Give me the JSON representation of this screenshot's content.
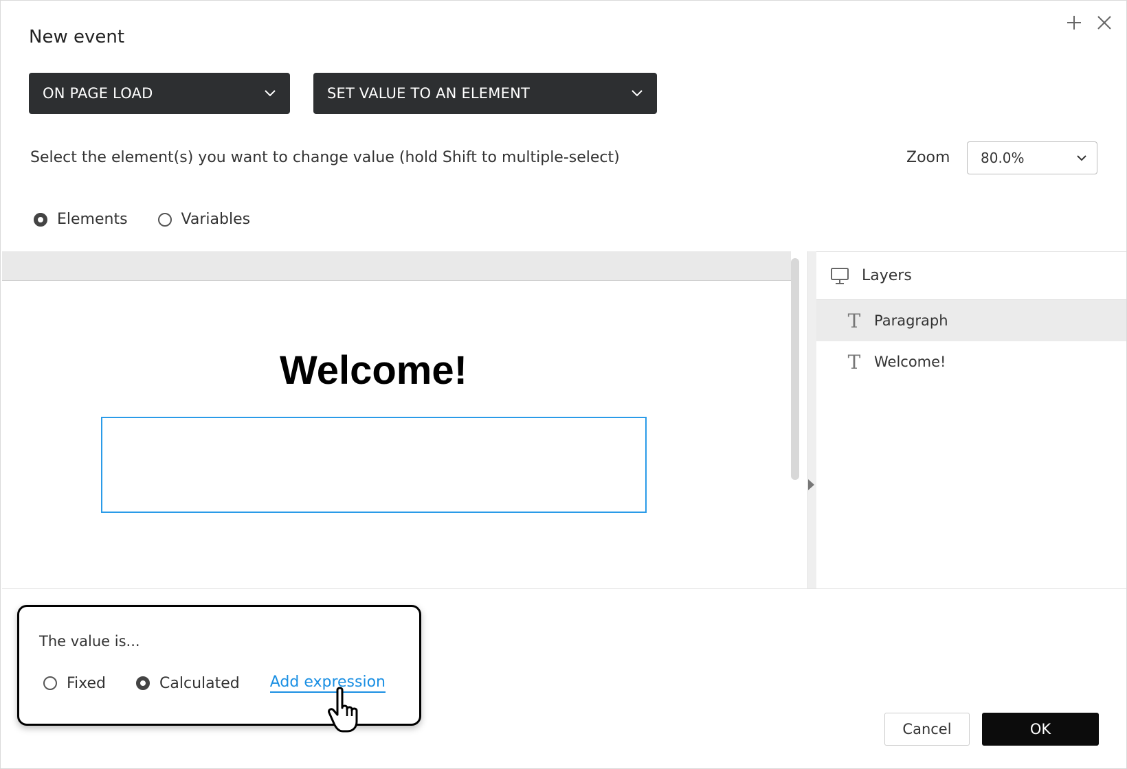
{
  "dialog": {
    "title": "New event",
    "icons": [
      "plus-icon",
      "close-icon"
    ]
  },
  "trigger_select": {
    "value": "ON PAGE LOAD"
  },
  "action_select": {
    "value": "SET VALUE TO AN ELEMENT"
  },
  "instruction": "Select the element(s) you want to change value (hold Shift to multiple-select)",
  "zoom": {
    "label": "Zoom",
    "value": "80.0%"
  },
  "target_type": {
    "options": [
      {
        "label": "Elements",
        "selected": true
      },
      {
        "label": "Variables",
        "selected": false
      }
    ]
  },
  "canvas": {
    "heading": "Welcome!"
  },
  "layers": {
    "title": "Layers",
    "items": [
      {
        "label": "Paragraph",
        "selected": true
      },
      {
        "label": "Welcome!",
        "selected": false
      }
    ]
  },
  "value_panel": {
    "label": "The value is...",
    "options": [
      {
        "label": "Fixed",
        "selected": false
      },
      {
        "label": "Calculated",
        "selected": true
      }
    ],
    "link": "Add expression"
  },
  "footer": {
    "cancel": "Cancel",
    "ok": "OK"
  },
  "colors": {
    "dark": "#2d2f31",
    "accent": "#1a8fe3",
    "selection": "#2a9be8"
  }
}
